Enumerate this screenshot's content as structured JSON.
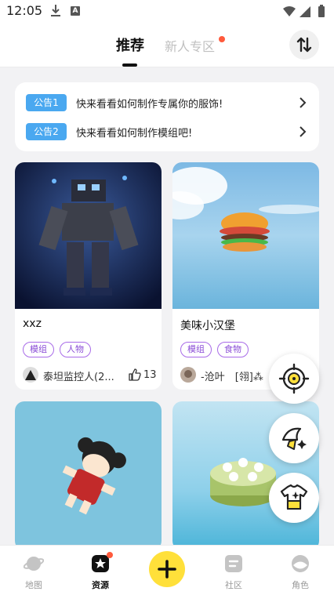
{
  "status_bar": {
    "time": "12:05",
    "icons": [
      "download-icon",
      "a-badge-icon",
      "wifi-icon",
      "signal-icon",
      "battery-icon"
    ],
    "a_badge": "A"
  },
  "tabs": [
    {
      "label": "推荐",
      "active": true
    },
    {
      "label": "新人专区",
      "active": false,
      "has_dot": true
    }
  ],
  "sort_button_icon": "sort-swap-icon",
  "notices": [
    {
      "tag": "公告1",
      "text": "快来看看如何制作专属你的服饰!"
    },
    {
      "tag": "公告2",
      "text": "快来看看如何制作模组吧!"
    }
  ],
  "cards": [
    {
      "title": "xxz",
      "tags": [
        "模组",
        "人物"
      ],
      "author": "泰坦监控人(2...",
      "likes": "13"
    },
    {
      "title": "美味小汉堡",
      "tags": [
        "模组",
        "食物"
      ],
      "author": "-沧叶　[翎]⁂",
      "likes": ""
    },
    {
      "title": "",
      "tags": [],
      "author": "",
      "likes": ""
    },
    {
      "title": "",
      "tags": [],
      "author": "",
      "likes": ""
    }
  ],
  "fabs": [
    "target-scope-icon",
    "magic-hat-icon",
    "shirt-sparkle-icon"
  ],
  "bottom_nav": [
    {
      "label": "地图",
      "icon": "planet-icon",
      "active": false
    },
    {
      "label": "资源",
      "icon": "star-box-icon",
      "active": true,
      "has_dot": true
    },
    {
      "label": "",
      "icon": "plus-icon",
      "active": false
    },
    {
      "label": "社区",
      "icon": "community-icon",
      "active": false
    },
    {
      "label": "角色",
      "icon": "character-icon",
      "active": false
    }
  ],
  "colors": {
    "accent_yellow": "#ffe03a",
    "notice_blue": "#4aa8f0",
    "tag_purple": "#8a4cd6",
    "dot_red": "#ff5a3c"
  }
}
